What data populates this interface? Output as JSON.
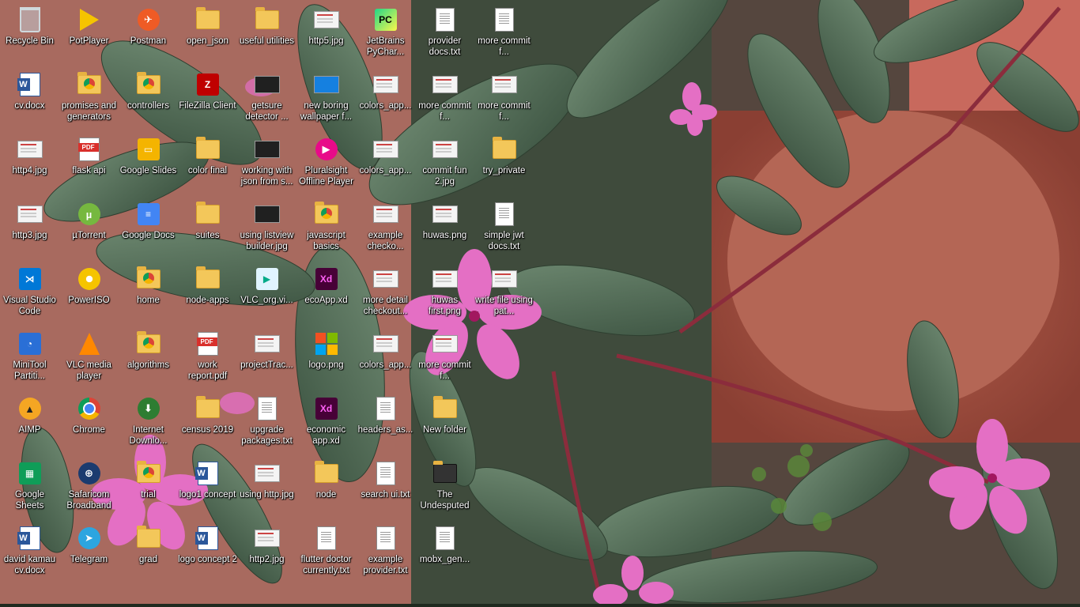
{
  "desktop": {
    "columns": [
      [
        {
          "label": "Recycle Bin",
          "icon": "recycle-bin-icon"
        },
        {
          "label": "cv.docx",
          "icon": "word-document-icon"
        },
        {
          "label": "http4.jpg",
          "icon": "image-file-icon"
        },
        {
          "label": "http3.jpg",
          "icon": "image-file-icon"
        },
        {
          "label": "Visual Studio Code",
          "icon": "vscode-icon"
        },
        {
          "label": "MiniTool Partiti...",
          "icon": "minitool-partition-icon"
        },
        {
          "label": "AIMP",
          "icon": "aimp-icon"
        },
        {
          "label": "Google Sheets",
          "icon": "google-sheets-icon"
        },
        {
          "label": "david kamau cv.docx",
          "icon": "word-document-icon"
        }
      ],
      [
        {
          "label": "PotPlayer",
          "icon": "potplayer-icon"
        },
        {
          "label": "promises and generators",
          "icon": "chrome-folder-icon"
        },
        {
          "label": "flask api",
          "icon": "pdf-file-icon"
        },
        {
          "label": "µTorrent",
          "icon": "utorrent-icon"
        },
        {
          "label": "PowerISO",
          "icon": "poweriso-icon"
        },
        {
          "label": "VLC media player",
          "icon": "vlc-icon"
        },
        {
          "label": "Chrome",
          "icon": "chrome-icon"
        },
        {
          "label": "Safaricom Broadband",
          "icon": "safaricom-icon"
        },
        {
          "label": "Telegram",
          "icon": "telegram-icon"
        }
      ],
      [
        {
          "label": "Postman",
          "icon": "postman-icon"
        },
        {
          "label": "controllers",
          "icon": "chrome-folder-icon"
        },
        {
          "label": "Google Slides",
          "icon": "google-slides-icon"
        },
        {
          "label": "Google Docs",
          "icon": "google-docs-icon"
        },
        {
          "label": "home",
          "icon": "chrome-folder-icon"
        },
        {
          "label": "algorithms",
          "icon": "chrome-folder-icon"
        },
        {
          "label": "Internet Downlo...",
          "icon": "internet-download-manager-icon"
        },
        {
          "label": "trial",
          "icon": "chrome-folder-icon"
        },
        {
          "label": "grad",
          "icon": "folder-icon"
        }
      ],
      [
        {
          "label": "open_json",
          "icon": "folder-icon"
        },
        {
          "label": "FileZilla Client",
          "icon": "filezilla-icon"
        },
        {
          "label": "color final",
          "icon": "folder-icon"
        },
        {
          "label": "suites",
          "icon": "folder-icon"
        },
        {
          "label": "node-apps",
          "icon": "folder-icon"
        },
        {
          "label": "work report.pdf",
          "icon": "pdf-file-icon"
        },
        {
          "label": "census 2019",
          "icon": "folder-icon"
        },
        {
          "label": "logo1 concept",
          "icon": "word-document-icon"
        },
        {
          "label": "logo concept 2",
          "icon": "word-document-icon"
        }
      ],
      [
        {
          "label": "useful utilities",
          "icon": "folder-icon"
        },
        {
          "label": "getsure detector ...",
          "icon": "dark-image-file-icon"
        },
        {
          "label": "working with json from s...",
          "icon": "dark-image-file-icon"
        },
        {
          "label": "using listview builder.jpg",
          "icon": "dark-image-file-icon"
        },
        {
          "label": "VLC_org.vi...",
          "icon": "vlc-file-icon"
        },
        {
          "label": "projectTrac...",
          "icon": "image-file-icon"
        },
        {
          "label": "upgrade packages.txt",
          "icon": "text-file-icon"
        },
        {
          "label": "using http.jpg",
          "icon": "image-file-icon"
        },
        {
          "label": "http2.jpg",
          "icon": "image-file-icon"
        }
      ],
      [
        {
          "label": "http5.jpg",
          "icon": "image-file-icon"
        },
        {
          "label": "new boring wallpaper f...",
          "icon": "blue-image-file-icon"
        },
        {
          "label": "Pluralsight Offline Player",
          "icon": "pluralsight-icon"
        },
        {
          "label": "javascript basics",
          "icon": "chrome-folder-icon"
        },
        {
          "label": "ecoApp.xd",
          "icon": "adobe-xd-icon"
        },
        {
          "label": "logo.png",
          "icon": "windows-logo-icon"
        },
        {
          "label": "economic app.xd",
          "icon": "adobe-xd-icon"
        },
        {
          "label": "node",
          "icon": "folder-icon"
        },
        {
          "label": "flutter doctor currently.txt",
          "icon": "text-file-icon"
        }
      ],
      [
        {
          "label": "JetBrains PyChar...",
          "icon": "pycharm-icon"
        },
        {
          "label": "colors_app...",
          "icon": "image-file-icon"
        },
        {
          "label": "colors_app...",
          "icon": "image-file-icon"
        },
        {
          "label": "example checko...",
          "icon": "image-file-icon"
        },
        {
          "label": "more detail checkout...",
          "icon": "image-file-icon"
        },
        {
          "label": "colors_app...",
          "icon": "image-file-icon"
        },
        {
          "label": "headers_as...",
          "icon": "text-file-icon"
        },
        {
          "label": "search ui.txt",
          "icon": "text-file-icon"
        },
        {
          "label": "example provider.txt",
          "icon": "text-file-icon"
        }
      ],
      [
        {
          "label": "provider docs.txt",
          "icon": "text-file-icon"
        },
        {
          "label": "more commit f...",
          "icon": "image-file-icon"
        },
        {
          "label": "commit fun 2.jpg",
          "icon": "image-file-icon"
        },
        {
          "label": "huwas.png",
          "icon": "image-file-icon"
        },
        {
          "label": "huwas first.png",
          "icon": "image-file-icon"
        },
        {
          "label": "more commit f...",
          "icon": "image-file-icon"
        },
        {
          "label": "New folder",
          "icon": "folder-icon"
        },
        {
          "label": "The Undesputed",
          "icon": "dark-folder-icon"
        },
        {
          "label": "mobx_gen...",
          "icon": "text-file-icon"
        }
      ],
      [
        {
          "label": "more commit f...",
          "icon": "text-file-icon"
        },
        {
          "label": "more commit f...",
          "icon": "image-file-icon"
        },
        {
          "label": "try_private",
          "icon": "folder-icon"
        },
        {
          "label": "simple jwt docs.txt",
          "icon": "text-file-icon"
        },
        {
          "label": "write file using pat...",
          "icon": "image-file-icon"
        }
      ]
    ]
  }
}
